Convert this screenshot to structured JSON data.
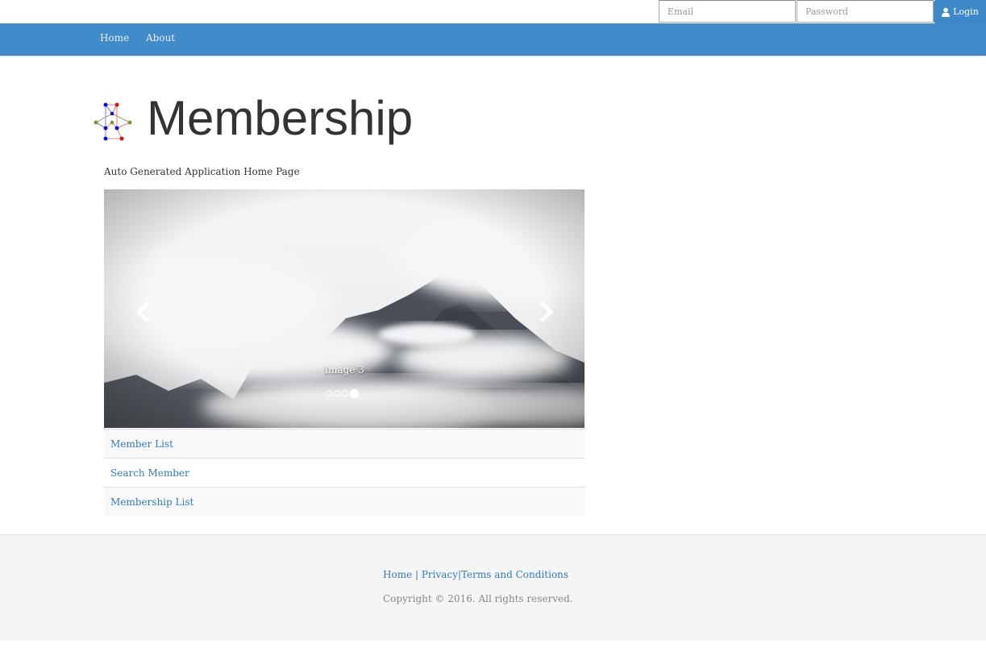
{
  "login": {
    "email_placeholder": "Email",
    "password_placeholder": "Password",
    "login_label": "Login",
    "login_icon": "user-icon"
  },
  "nav": {
    "home": "Home",
    "about": "About"
  },
  "header": {
    "title": "Membership",
    "subtitle": "Auto Generated Application Home Page",
    "logo_icon": "network-graph-logo"
  },
  "carousel": {
    "caption": "Image 3",
    "slide_count": 4,
    "active_index": 3,
    "prev_icon": "chevron-left-icon",
    "next_icon": "chevron-right-icon"
  },
  "links": [
    {
      "label": "Member List"
    },
    {
      "label": "Search Member"
    },
    {
      "label": "Membership List"
    }
  ],
  "footer": {
    "home": "Home",
    "sep1": " | ",
    "privacy": "Privacy",
    "sep2": "|",
    "terms": "Terms and Conditions",
    "copyright": "Copyright © 2016. All rights reserved."
  },
  "colors": {
    "navbar": "#428bca",
    "link": "#337ab7"
  }
}
